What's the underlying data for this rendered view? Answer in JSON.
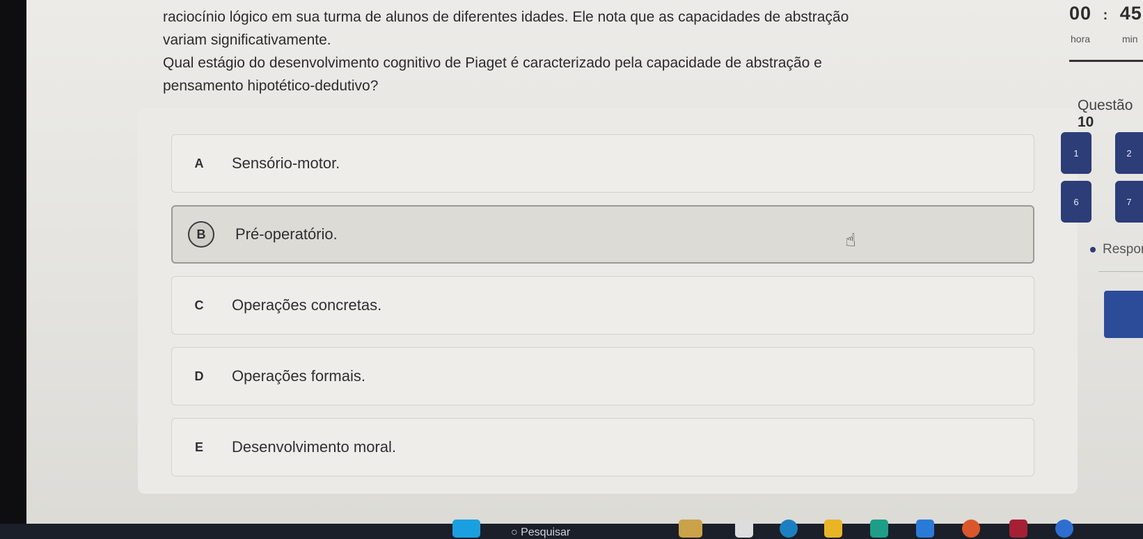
{
  "question": {
    "line1": "raciocínio lógico em sua turma de alunos de diferentes idades. Ele nota que as capacidades de abstração",
    "line2": "variam significativamente.",
    "line3": "Qual estágio do desenvolvimento cognitivo de Piaget é caracterizado pela capacidade de abstração e",
    "line4": "pensamento hipotético-dedutivo?"
  },
  "options": [
    {
      "letter": "A",
      "text": "Sensório-motor."
    },
    {
      "letter": "B",
      "text": "Pré-operatório."
    },
    {
      "letter": "C",
      "text": "Operações concretas."
    },
    {
      "letter": "D",
      "text": "Operações formais."
    },
    {
      "letter": "E",
      "text": "Desenvolvimento moral."
    }
  ],
  "timer": {
    "hours": "00",
    "minutes": "45",
    "sep": ":",
    "hours_label": "hora",
    "minutes_label": "min"
  },
  "sidebar": {
    "question_label": "Questão",
    "question_number": "10",
    "nav": [
      "1",
      "2",
      "6",
      "7"
    ],
    "legend": "Respond"
  },
  "taskbar": {
    "search_placeholder": "Pesquisar"
  },
  "colors": {
    "accent": "#2c3d78",
    "primary_button": "#2c4c9a"
  }
}
